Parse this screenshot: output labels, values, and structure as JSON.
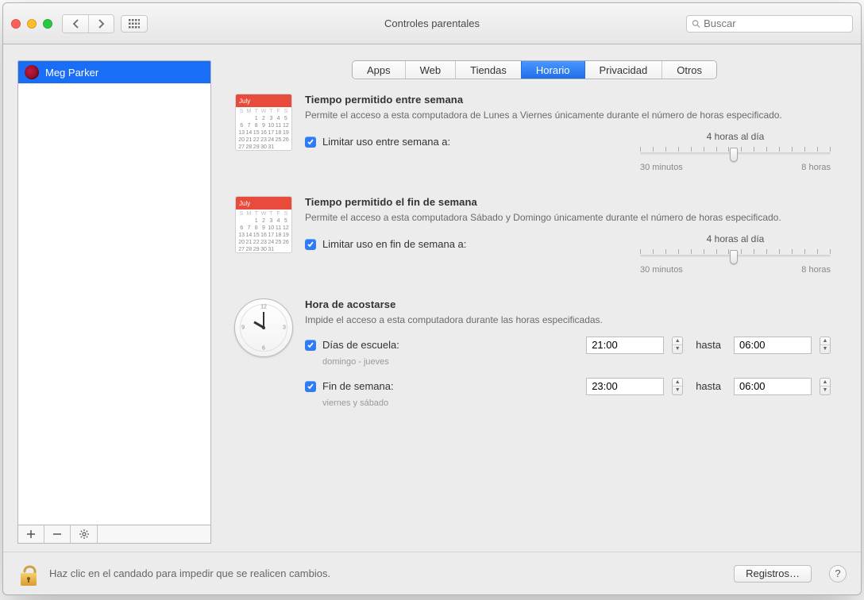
{
  "window": {
    "title": "Controles parentales",
    "search_placeholder": "Buscar"
  },
  "sidebar": {
    "users": [
      {
        "name": "Meg Parker"
      }
    ]
  },
  "tabs": [
    {
      "label": "Apps",
      "active": false
    },
    {
      "label": "Web",
      "active": false
    },
    {
      "label": "Tiendas",
      "active": false
    },
    {
      "label": "Horario",
      "active": true
    },
    {
      "label": "Privacidad",
      "active": false
    },
    {
      "label": "Otros",
      "active": false
    }
  ],
  "weekday": {
    "title": "Tiempo permitido entre semana",
    "desc": "Permite el acceso a esta computadora de Lunes a Viernes únicamente durante el número de horas especificado.",
    "checkbox_label": "Limitar uso entre semana a:",
    "checked": true,
    "slider": {
      "value_label": "4 horas al día",
      "min_label": "30 minutos",
      "max_label": "8 horas",
      "percent": 47
    }
  },
  "weekend": {
    "title": "Tiempo permitido el fin de semana",
    "desc": "Permite el acceso a esta computadora Sábado y Domingo únicamente durante el número de horas especificado.",
    "checkbox_label": "Limitar uso en fin de semana a:",
    "checked": true,
    "slider": {
      "value_label": "4 horas al día",
      "min_label": "30 minutos",
      "max_label": "8 horas",
      "percent": 47
    }
  },
  "bedtime": {
    "title": "Hora de acostarse",
    "desc": "Impide el acceso a esta computadora durante las horas especificadas.",
    "school": {
      "label": "Días de escuela:",
      "sub": "domingo - jueves",
      "from": "21:00",
      "to_label": "hasta",
      "to": "06:00",
      "checked": true
    },
    "wkend": {
      "label": "Fin de semana:",
      "sub": "viernes y sábado",
      "from": "23:00",
      "to_label": "hasta",
      "to": "06:00",
      "checked": true
    }
  },
  "lock_msg": "Haz clic en el candado para impedir que se realicen cambios.",
  "logs_btn": "Registros…",
  "calendar_month": "July"
}
